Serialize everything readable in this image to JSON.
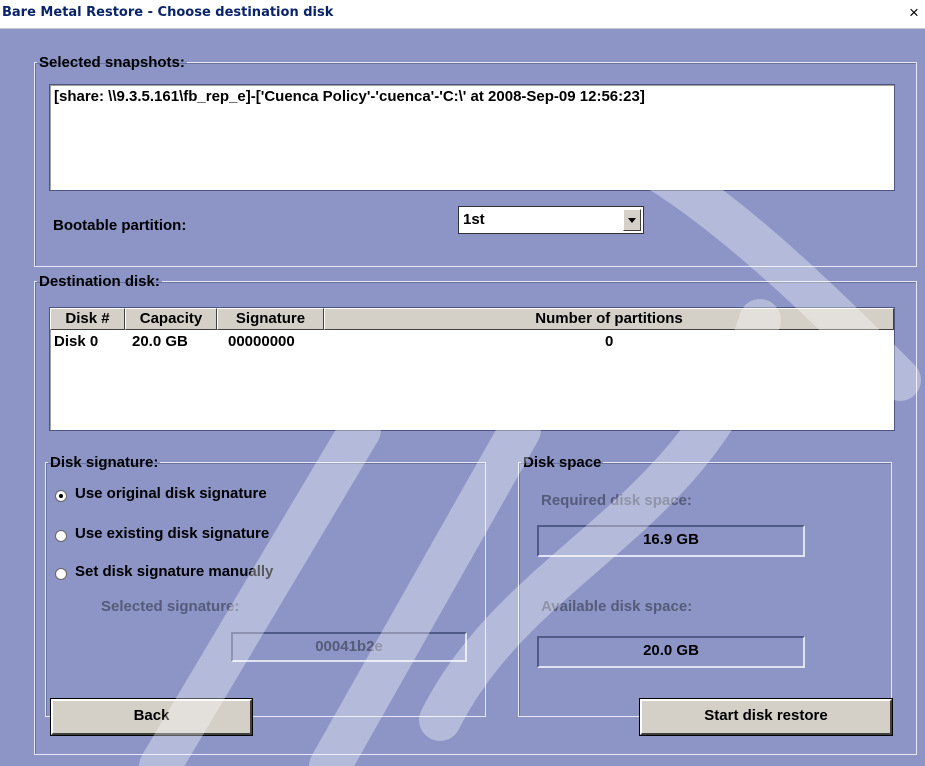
{
  "window": {
    "title": "Bare Metal Restore - Choose destination disk",
    "close_glyph": "×"
  },
  "snapshots": {
    "legend": "Selected snapshots:",
    "items": [
      "[share: \\\\9.3.5.161\\fb_rep_e]-['Cuenca Policy'-'cuenca'-'C:\\' at 2008-Sep-09 12:56:23]"
    ],
    "bootable_label": "Bootable partition:",
    "bootable_value": "1st"
  },
  "destination": {
    "legend": "Destination disk:",
    "columns": [
      "Disk #",
      "Capacity",
      "Signature",
      "Number of partitions"
    ],
    "rows": [
      {
        "disk": "Disk 0",
        "capacity": "20.0 GB",
        "signature": "00000000",
        "partitions": "0"
      }
    ]
  },
  "disk_signature": {
    "legend": "Disk signature:",
    "options": [
      "Use original disk signature",
      "Use existing disk signature",
      "Set disk signature manually"
    ],
    "selected_index": 0,
    "selected_signature_label": "Selected signature:",
    "selected_signature_value": "00041b2e"
  },
  "disk_space": {
    "legend": "Disk space",
    "required_label": "Required disk space:",
    "required_value": "16.9 GB",
    "available_label": "Available disk space:",
    "available_value": "20.0 GB"
  },
  "buttons": {
    "back": "Back",
    "start": "Start disk restore"
  }
}
